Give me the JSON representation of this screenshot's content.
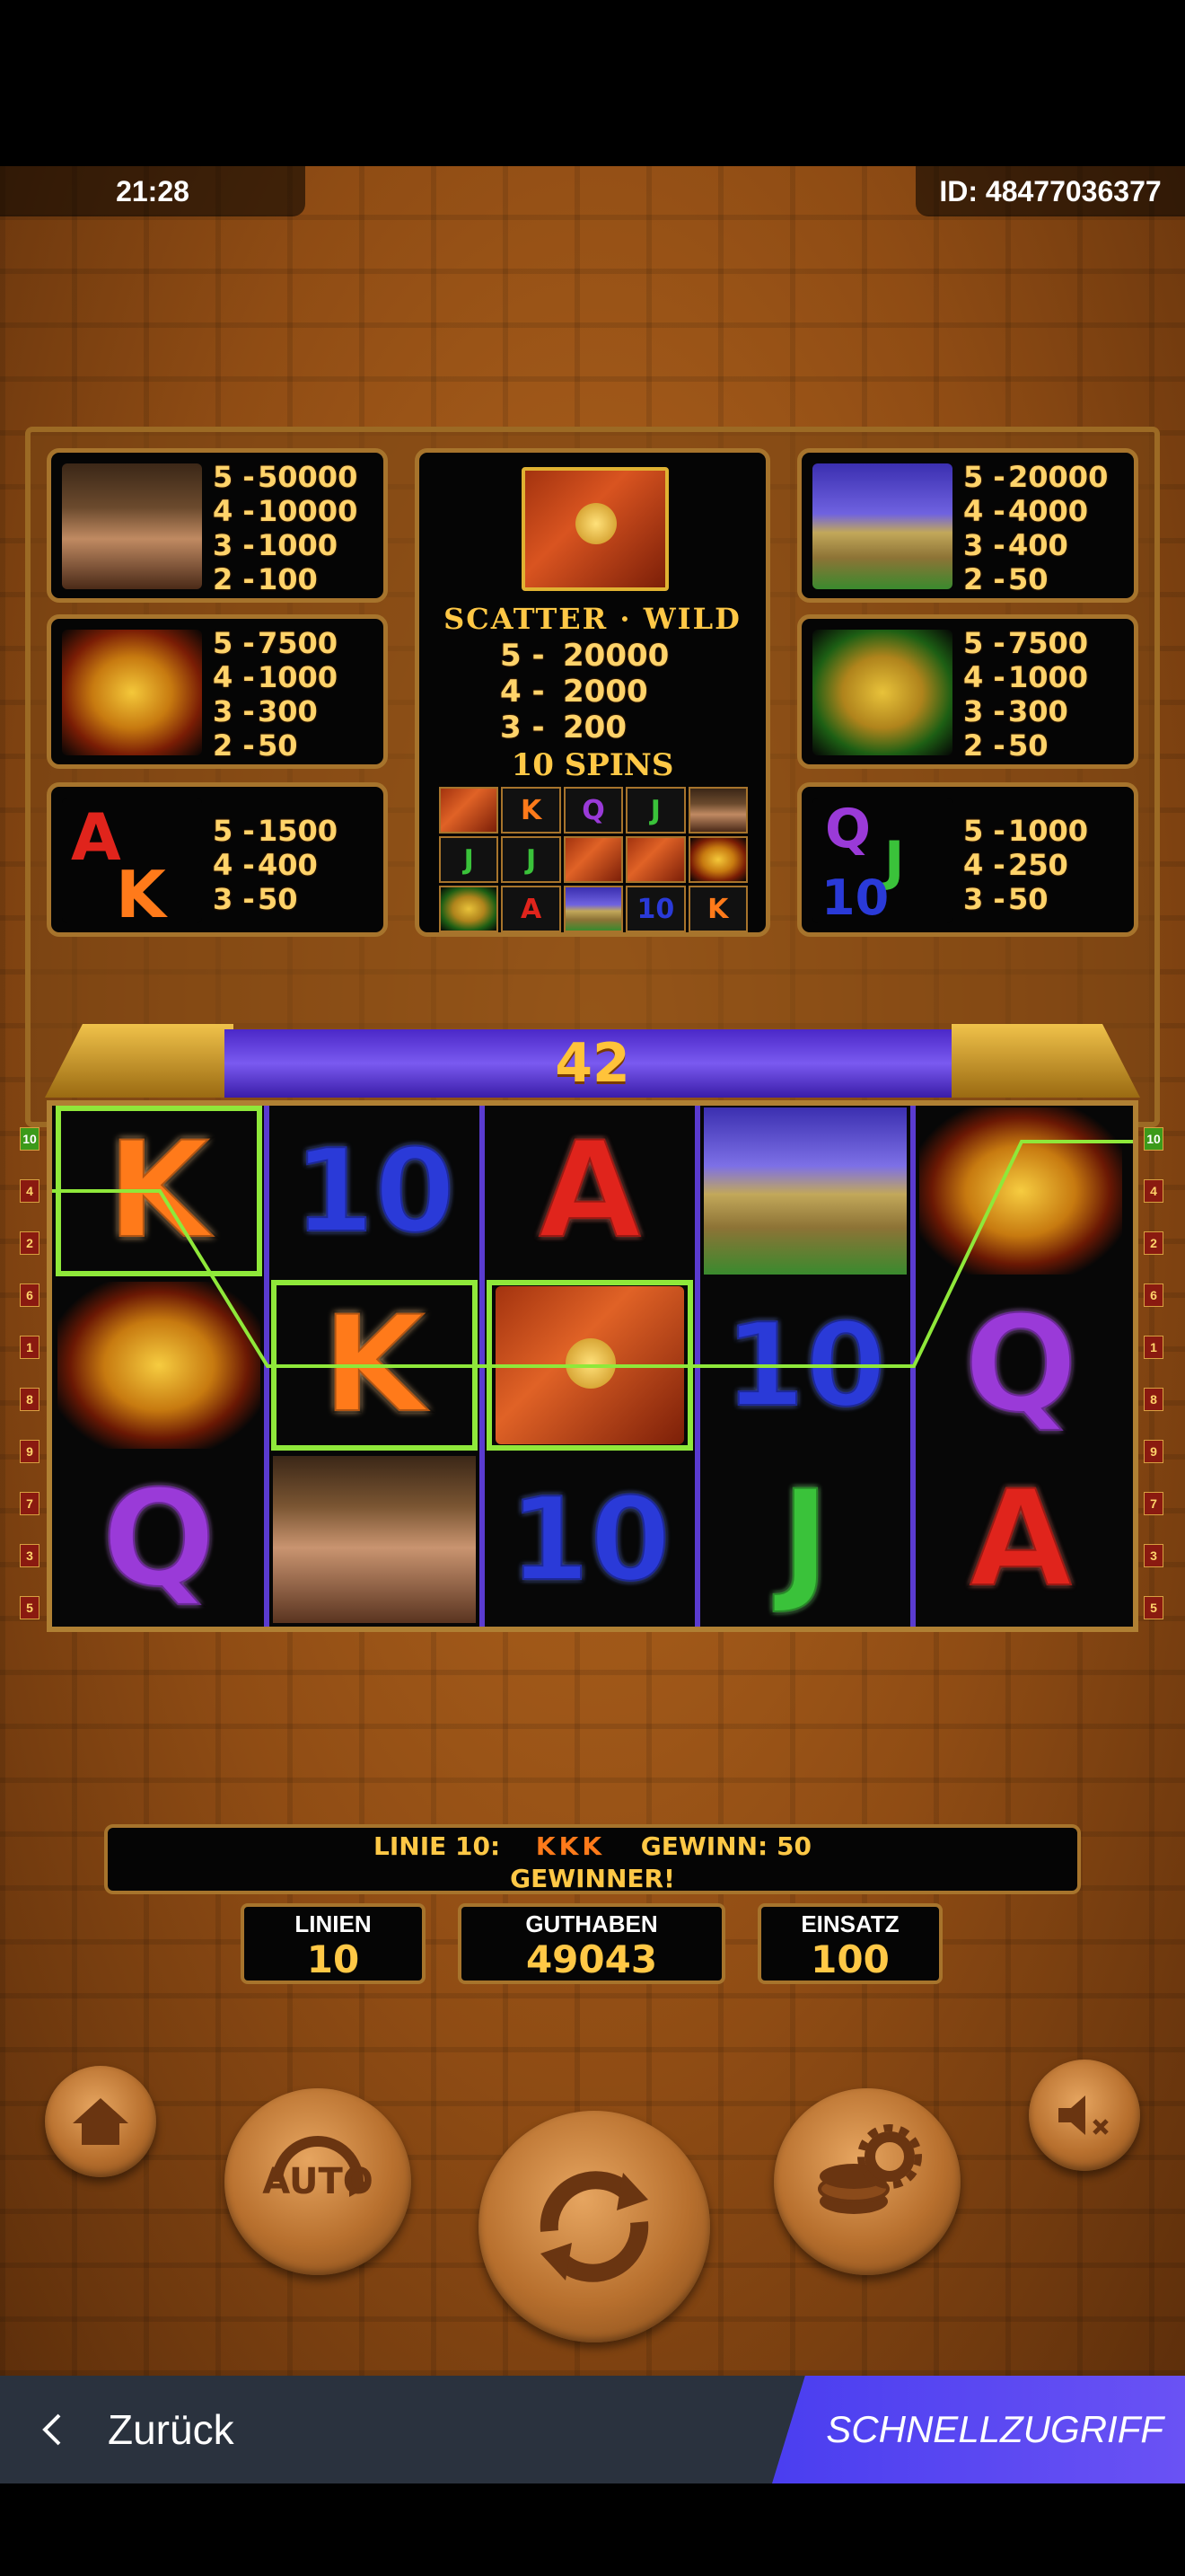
{
  "status": {
    "time": "21:28",
    "id": "ID: 48477036377"
  },
  "paytable": {
    "lady": [
      {
        "k": "5 -",
        "v": "50000"
      },
      {
        "k": "4 -",
        "v": "10000"
      },
      {
        "k": "3 -",
        "v": "1000"
      },
      {
        "k": "2 -",
        "v": "100"
      }
    ],
    "fish": [
      {
        "k": "5 -",
        "v": "7500"
      },
      {
        "k": "4 -",
        "v": "1000"
      },
      {
        "k": "3 -",
        "v": "300"
      },
      {
        "k": "2 -",
        "v": "50"
      }
    ],
    "ak": [
      {
        "k": "5 -",
        "v": "1500"
      },
      {
        "k": "4 -",
        "v": "400"
      },
      {
        "k": "3 -",
        "v": "50"
      }
    ],
    "pyramid": [
      {
        "k": "5 -",
        "v": "20000"
      },
      {
        "k": "4 -",
        "v": "4000"
      },
      {
        "k": "3 -",
        "v": "400"
      },
      {
        "k": "2 -",
        "v": "50"
      }
    ],
    "jaguar": [
      {
        "k": "5 -",
        "v": "7500"
      },
      {
        "k": "4 -",
        "v": "1000"
      },
      {
        "k": "3 -",
        "v": "300"
      },
      {
        "k": "2 -",
        "v": "50"
      }
    ],
    "qj10": [
      {
        "k": "5 -",
        "v": "1000"
      },
      {
        "k": "4 -",
        "v": "250"
      },
      {
        "k": "3 -",
        "v": "50"
      }
    ],
    "scatter_title": "SCATTER · WILD",
    "scatter": [
      {
        "k": "5 -",
        "v": "20000"
      },
      {
        "k": "4 -",
        "v": "2000"
      },
      {
        "k": "3 -",
        "v": "200"
      }
    ],
    "spins_title": "10 SPINS",
    "ak_letters": [
      "A",
      "K"
    ],
    "qj_letters": [
      "Q",
      "J",
      "10"
    ],
    "mini_grid": [
      "book",
      "K",
      "Q",
      "J",
      "lady",
      "J",
      "J",
      "book",
      "book",
      "fish",
      "jaguar",
      "A",
      "pyramid",
      "10",
      "K"
    ]
  },
  "win_counter": "42",
  "reels": [
    [
      "K",
      "fish",
      "Q"
    ],
    [
      "10",
      "K",
      "lady"
    ],
    [
      "A",
      "book",
      "10"
    ],
    [
      "pyramid",
      "10",
      "J"
    ],
    [
      "fish",
      "Q",
      "A"
    ]
  ],
  "highlighted": [
    [
      0,
      0
    ],
    [
      1,
      1
    ],
    [
      2,
      1
    ]
  ],
  "line_markers": {
    "left": [
      "10",
      "4",
      "2",
      "6",
      "1",
      "8",
      "9",
      "7",
      "3",
      "5"
    ],
    "right": [
      "10",
      "4",
      "2",
      "6",
      "1",
      "8",
      "9",
      "7",
      "3",
      "5"
    ]
  },
  "win_message": {
    "line": "LINIE 10:",
    "symbols": "KKK",
    "gewinn": "GEWINN: 50",
    "status": "GEWINNER!"
  },
  "stats": {
    "linien_label": "LINIEN",
    "linien_value": "10",
    "guthaben_label": "GUTHABEN",
    "guthaben_value": "49043",
    "einsatz_label": "EINSATZ",
    "einsatz_value": "100"
  },
  "buttons": {
    "auto_label": "AUTO"
  },
  "nav": {
    "back_label": "Zurück",
    "quick_label": "SCHNELLZUGRIFF"
  },
  "colors": {
    "accent_purple": "#5a46f0",
    "gold": "#ffc846",
    "win_green": "#8fe83a"
  }
}
